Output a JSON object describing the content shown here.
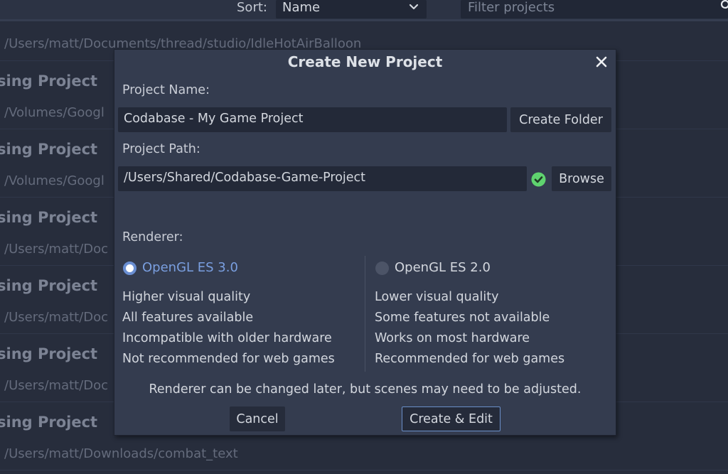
{
  "topbar": {
    "sort_label": "Sort:",
    "sort_value": "Name",
    "filter_placeholder": "Filter projects"
  },
  "project_list": [
    {
      "name": "",
      "path": "/Users/matt/Documents/thread/studio/IdleHotAirBalloon"
    },
    {
      "name": "sing Project",
      "path": "/Volumes/Googl"
    },
    {
      "name": "sing Project",
      "path": "/Volumes/Googl"
    },
    {
      "name": "sing Project",
      "path": "/Users/matt/Doc"
    },
    {
      "name": "sing Project",
      "path": "/Users/matt/Doc"
    },
    {
      "name": "sing Project",
      "path": "/Users/matt/Doc"
    },
    {
      "name": "sing Project",
      "path": "/Users/matt/Downloads/combat_text"
    }
  ],
  "dialog": {
    "title": "Create New Project",
    "project_name_label": "Project Name:",
    "project_name_value": "Codabase - My Game Project",
    "create_folder_label": "Create Folder",
    "project_path_label": "Project Path:",
    "project_path_value": "/Users/Shared/Codabase-Game-Project",
    "path_status": "valid",
    "browse_label": "Browse",
    "renderer_label": "Renderer:",
    "renderers": [
      {
        "label": "OpenGL ES 3.0",
        "selected": true,
        "features": [
          "Higher visual quality",
          "All features available",
          "Incompatible with older hardware",
          "Not recommended for web games"
        ]
      },
      {
        "label": "OpenGL ES 2.0",
        "selected": false,
        "features": [
          "Lower visual quality",
          "Some features not available",
          "Works on most hardware",
          "Recommended for web games"
        ]
      }
    ],
    "note": "Renderer can be changed later, but scenes may need to be adjusted.",
    "cancel_label": "Cancel",
    "create_edit_label": "Create & Edit"
  },
  "colors": {
    "accent": "#6a8fd3",
    "valid_green": "#5fd36f",
    "dialog_bg": "#343c4f",
    "background": "#272d3c"
  }
}
